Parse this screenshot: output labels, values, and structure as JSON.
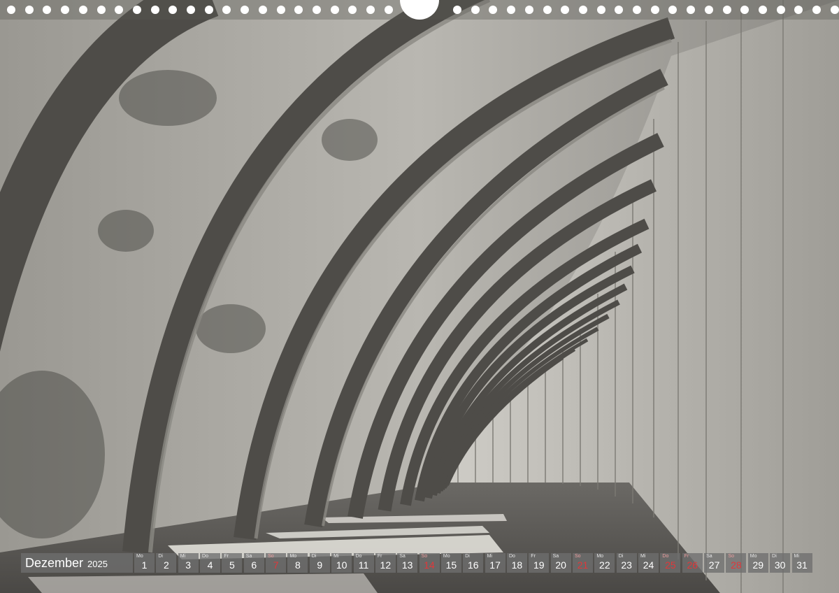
{
  "calendar": {
    "month": "Dezember",
    "year": "2025",
    "days": [
      {
        "wd": "Mo",
        "n": "1",
        "sun": false
      },
      {
        "wd": "Di",
        "n": "2",
        "sun": false
      },
      {
        "wd": "Mi",
        "n": "3",
        "sun": false
      },
      {
        "wd": "Do",
        "n": "4",
        "sun": false
      },
      {
        "wd": "Fr",
        "n": "5",
        "sun": false
      },
      {
        "wd": "Sa",
        "n": "6",
        "sun": false
      },
      {
        "wd": "So",
        "n": "7",
        "sun": true
      },
      {
        "wd": "Mo",
        "n": "8",
        "sun": false
      },
      {
        "wd": "Di",
        "n": "9",
        "sun": false
      },
      {
        "wd": "Mi",
        "n": "10",
        "sun": false
      },
      {
        "wd": "Do",
        "n": "11",
        "sun": false
      },
      {
        "wd": "Fr",
        "n": "12",
        "sun": false
      },
      {
        "wd": "Sa",
        "n": "13",
        "sun": false
      },
      {
        "wd": "So",
        "n": "14",
        "sun": true
      },
      {
        "wd": "Mo",
        "n": "15",
        "sun": false
      },
      {
        "wd": "Di",
        "n": "16",
        "sun": false
      },
      {
        "wd": "Mi",
        "n": "17",
        "sun": false
      },
      {
        "wd": "Do",
        "n": "18",
        "sun": false
      },
      {
        "wd": "Fr",
        "n": "19",
        "sun": false
      },
      {
        "wd": "Sa",
        "n": "20",
        "sun": false
      },
      {
        "wd": "So",
        "n": "21",
        "sun": true
      },
      {
        "wd": "Mo",
        "n": "22",
        "sun": false
      },
      {
        "wd": "Di",
        "n": "23",
        "sun": false
      },
      {
        "wd": "Mi",
        "n": "24",
        "sun": false
      },
      {
        "wd": "Do",
        "n": "25",
        "sun": true
      },
      {
        "wd": "Fr",
        "n": "26",
        "sun": true
      },
      {
        "wd": "Sa",
        "n": "27",
        "sun": false
      },
      {
        "wd": "So",
        "n": "28",
        "sun": true
      },
      {
        "wd": "Mo",
        "n": "29",
        "sun": false
      },
      {
        "wd": "Di",
        "n": "30",
        "sun": false
      },
      {
        "wd": "Mi",
        "n": "31",
        "sun": false
      }
    ]
  },
  "colors": {
    "holiday": "#e0383a",
    "strip": "#6e6e6e"
  }
}
